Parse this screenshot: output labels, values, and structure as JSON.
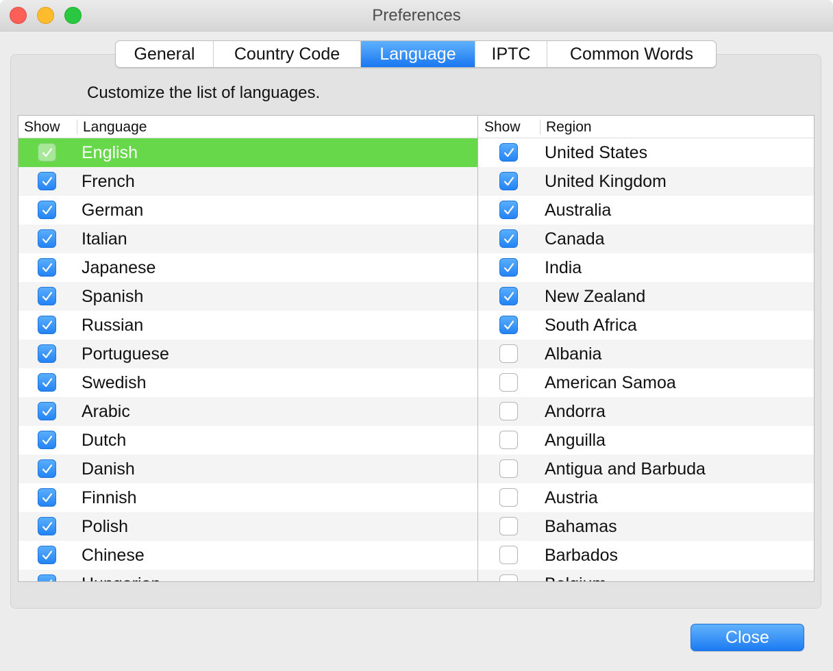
{
  "window": {
    "title": "Preferences"
  },
  "tabs": [
    {
      "label": "General",
      "active": false
    },
    {
      "label": "Country Code",
      "active": false
    },
    {
      "label": "Language",
      "active": true
    },
    {
      "label": "IPTC",
      "active": false
    },
    {
      "label": "Common Words",
      "active": false
    }
  ],
  "instructions": "Customize the list of languages.",
  "languages": {
    "header_show": "Show",
    "header_name": "Language",
    "items": [
      {
        "label": "English",
        "checked": true,
        "selected": true
      },
      {
        "label": "French",
        "checked": true
      },
      {
        "label": "German",
        "checked": true
      },
      {
        "label": "Italian",
        "checked": true
      },
      {
        "label": "Japanese",
        "checked": true
      },
      {
        "label": "Spanish",
        "checked": true
      },
      {
        "label": "Russian",
        "checked": true
      },
      {
        "label": "Portuguese",
        "checked": true
      },
      {
        "label": "Swedish",
        "checked": true
      },
      {
        "label": "Arabic",
        "checked": true
      },
      {
        "label": "Dutch",
        "checked": true
      },
      {
        "label": "Danish",
        "checked": true
      },
      {
        "label": "Finnish",
        "checked": true
      },
      {
        "label": "Polish",
        "checked": true
      },
      {
        "label": "Chinese",
        "checked": true
      },
      {
        "label": "Hungarian",
        "checked": true
      }
    ]
  },
  "regions": {
    "header_show": "Show",
    "header_name": "Region",
    "items": [
      {
        "label": "United States",
        "checked": true
      },
      {
        "label": "United Kingdom",
        "checked": true
      },
      {
        "label": "Australia",
        "checked": true
      },
      {
        "label": "Canada",
        "checked": true
      },
      {
        "label": "India",
        "checked": true
      },
      {
        "label": "New Zealand",
        "checked": true
      },
      {
        "label": "South Africa",
        "checked": true
      },
      {
        "label": "Albania",
        "checked": false
      },
      {
        "label": "American Samoa",
        "checked": false
      },
      {
        "label": "Andorra",
        "checked": false
      },
      {
        "label": "Anguilla",
        "checked": false
      },
      {
        "label": "Antigua and Barbuda",
        "checked": false
      },
      {
        "label": "Austria",
        "checked": false
      },
      {
        "label": "Bahamas",
        "checked": false
      },
      {
        "label": "Barbados",
        "checked": false
      },
      {
        "label": "Belgium",
        "checked": false
      }
    ]
  },
  "buttons": {
    "close_label": "Close"
  },
  "colors": {
    "accent_blue": "#1977f2",
    "selection_green": "#66d849",
    "traffic_close": "#fc5f57",
    "traffic_minimize": "#fdbc2e",
    "traffic_zoom": "#29c840"
  }
}
